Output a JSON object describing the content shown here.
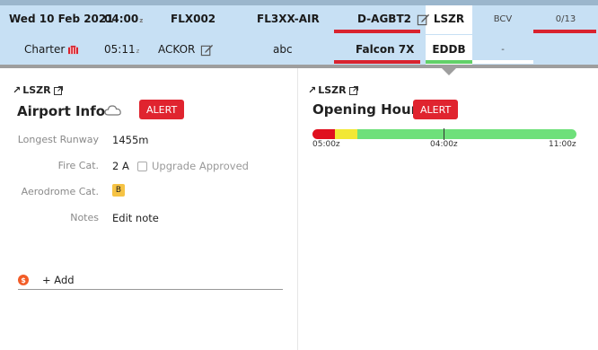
{
  "header": {
    "date": "Wed 10 Feb 2021",
    "time1": "04:00",
    "time1_suffix": "z",
    "flight": "FLX002",
    "callsign": "FL3XX-AIR",
    "registration": "D-AGBT2",
    "departure_airport": "LSZR",
    "airport3": "BCV",
    "pax_count": "0/13",
    "type": "Charter",
    "time2": "05:11",
    "time2_suffix": "z",
    "crew": "ACKOR",
    "note": "abc",
    "aircraft": "Falcon 7X",
    "arrival_airport": "EDDB",
    "airport3_row2": "-"
  },
  "left_panel": {
    "airport_link": "LSZR",
    "title": "Airport Info",
    "alert_label": "ALERT",
    "weather_icon": "cloud-icon",
    "fields": {
      "longest_runway_label": "Longest Runway",
      "longest_runway_value": "1455m",
      "fire_cat_label": "Fire Cat.",
      "fire_cat_value": "2 A",
      "upgrade_label": "Upgrade Approved",
      "aerodrome_cat_label": "Aerodrome Cat.",
      "aerodrome_cat_value": "B",
      "notes_label": "Notes",
      "notes_value": "Edit note"
    },
    "add_label": "+ Add"
  },
  "right_panel": {
    "airport_link": "LSZR",
    "title": "Opening Hours",
    "alert_label": "ALERT",
    "timeline": {
      "start_label": "05:00z",
      "mid_label": "04:00z",
      "end_label": "11:00z",
      "segments": [
        {
          "status": "closed",
          "color": "#e0101e",
          "fraction": 0.085
        },
        {
          "status": "restricted",
          "color": "#f2e834",
          "fraction": 0.085
        },
        {
          "status": "open",
          "color": "#6ee07a",
          "fraction": 0.83
        }
      ]
    }
  },
  "colors": {
    "header_bg": "#c7e0f4",
    "alert": "#e0242f",
    "red_bar": "#d9232e",
    "green_bar": "#62d169"
  }
}
